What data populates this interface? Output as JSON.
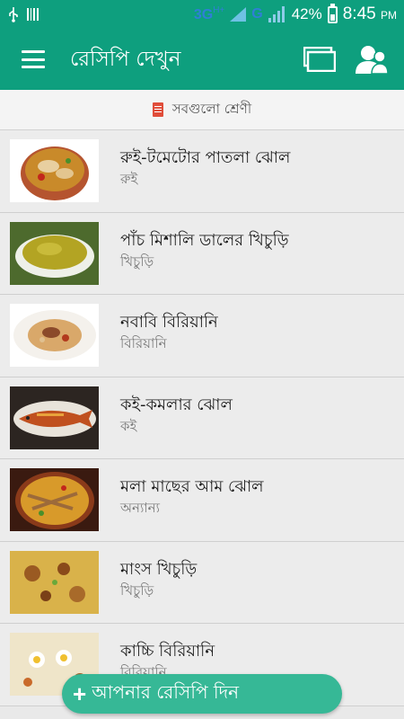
{
  "status_bar": {
    "network_label": "3G",
    "network_sup": "H+",
    "network_g": "G",
    "battery": "42%",
    "battery_level": 0.42,
    "time": "8:45",
    "ampm": "PM"
  },
  "app_bar": {
    "title": "রেসিপি দেখুন",
    "icons": [
      "menu-icon",
      "cards-icon",
      "users-icon"
    ]
  },
  "category_filter": {
    "label": "সবগুলো শ্রেণী",
    "icon": "book-icon"
  },
  "recipes": [
    {
      "title": "রুই-টমেটোর পাতলা ঝোল",
      "category": "রুই"
    },
    {
      "title": "পাঁচ মিশালি ডালের খিচুড়ি",
      "category": "খিচুড়ি"
    },
    {
      "title": "নবাবি বিরিয়ানি",
      "category": "বিরিয়ানি"
    },
    {
      "title": "কই-কমলার ঝোল",
      "category": "কই"
    },
    {
      "title": "মলা মাছের আম ঝোল",
      "category": "অন্যান্য"
    },
    {
      "title": "মাংস খিচুড়ি",
      "category": "খিচুড়ি"
    },
    {
      "title": "কাচ্চি বিরিয়ানি",
      "category": "বিরিয়ানি"
    }
  ],
  "fab": {
    "plus": "+",
    "label": "আপনার রেসিপি দিন"
  },
  "colors": {
    "primary": "#0e9f7e",
    "fab": "#36b896",
    "list_bg": "#ececec"
  }
}
